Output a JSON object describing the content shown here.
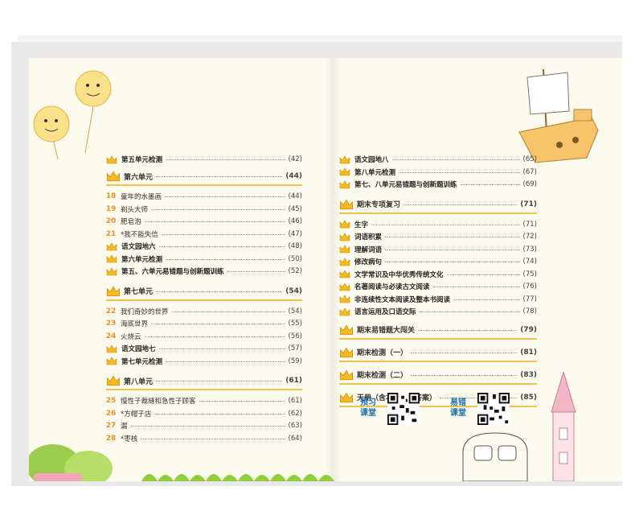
{
  "left_column": {
    "top_row": {
      "title": "第五单元检测",
      "page": "(42)"
    },
    "units": [
      {
        "name": "第六单元",
        "page": "(44)",
        "items": [
          {
            "num": "18",
            "title": "童年的水墨画",
            "page": "(44)"
          },
          {
            "num": "19",
            "title": "剃头大师",
            "page": "(45)"
          },
          {
            "num": "20",
            "title": "肥皂泡",
            "page": "(46)"
          },
          {
            "num": "21",
            "title": "*我不能失信",
            "page": "(47)"
          },
          {
            "num": "",
            "title": "语文园地六",
            "page": "(48)"
          },
          {
            "num": "",
            "title": "第六单元检测",
            "page": "(50)"
          },
          {
            "num": "",
            "title": "第五、六单元易错题与创新题训练",
            "page": "(52)"
          }
        ]
      },
      {
        "name": "第七单元",
        "page": "(54)",
        "items": [
          {
            "num": "22",
            "title": "我们奇妙的世界",
            "page": "(54)"
          },
          {
            "num": "23",
            "title": "海底世界",
            "page": "(55)"
          },
          {
            "num": "24",
            "title": "火烧云",
            "page": "(56)"
          },
          {
            "num": "",
            "title": "语文园地七",
            "page": "(57)"
          },
          {
            "num": "",
            "title": "第七单元检测",
            "page": "(59)"
          }
        ]
      },
      {
        "name": "第八单元",
        "page": "(61)",
        "items": [
          {
            "num": "25",
            "title": "慢性子裁缝和急性子顾客",
            "page": "(61)"
          },
          {
            "num": "26",
            "title": "*方帽子店",
            "page": "(62)"
          },
          {
            "num": "27",
            "title": "漏",
            "page": "(63)"
          },
          {
            "num": "28",
            "title": "*枣核",
            "page": "(64)"
          }
        ]
      }
    ]
  },
  "right_column": {
    "top_rows": [
      {
        "title": "语文园地八",
        "page": "(65)"
      },
      {
        "title": "第八单元检测",
        "page": "(67)"
      },
      {
        "title": "第七、八单元易错题与创新题训练",
        "page": "(69)"
      }
    ],
    "review_section": {
      "name": "期末专项复习",
      "page": "(71)",
      "items": [
        {
          "title": "生字",
          "page": "(71)"
        },
        {
          "title": "词语积累",
          "page": "(72)"
        },
        {
          "title": "理解词语",
          "page": "(73)"
        },
        {
          "title": "修改病句",
          "page": "(74)"
        },
        {
          "title": "文学常识及中华优秀传统文化",
          "page": "(75)"
        },
        {
          "title": "名著阅读与必读古文阅读",
          "page": "(76)"
        },
        {
          "title": "非连续性文本阅读及整本书阅读",
          "page": "(77)"
        },
        {
          "title": "语言运用及口语交际",
          "page": "(78)"
        }
      ]
    },
    "extra_sections": [
      {
        "name": "期末易错题大闯关",
        "page": "(79)"
      },
      {
        "name": "期末检测（一）",
        "page": "(81)"
      },
      {
        "name": "期末检测（二）",
        "page": "(83)"
      },
      {
        "name": "天册（含本书参考答案）",
        "page": "(85)"
      }
    ],
    "qr_codes": [
      {
        "label": "预习课堂"
      },
      {
        "label": "易错课堂"
      }
    ]
  },
  "colors": {
    "page_bg": "#fdfbee",
    "accent": "#f2c24e",
    "number": "#e8902a",
    "qr_label": "#1a6fb0"
  }
}
